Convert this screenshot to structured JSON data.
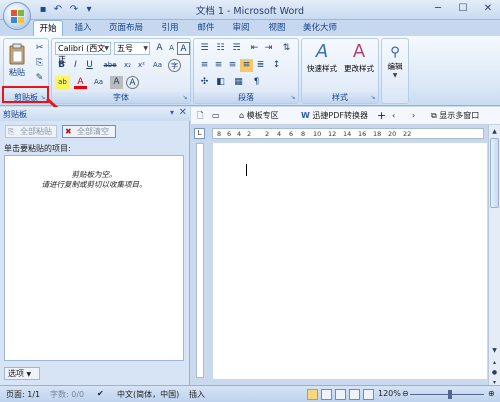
{
  "title_bar": {
    "title": "文档 1 - Microsoft Word",
    "quick_access": [
      "save-icon",
      "undo-icon",
      "redo-icon",
      "customize-icon"
    ],
    "window_buttons": [
      "minimize",
      "maximize",
      "close"
    ]
  },
  "ribbon_tabs": [
    "开始",
    "插入",
    "页面布局",
    "引用",
    "邮件",
    "审阅",
    "视图",
    "美化大师"
  ],
  "active_tab": "开始",
  "clipboard_group": {
    "paste_label": "粘贴",
    "group_label": "剪贴板"
  },
  "font_group": {
    "font_name": "Calibri (西文正",
    "font_size": "五号",
    "group_label": "字体",
    "buttons_row1": [
      "A",
      "A",
      "变",
      "A"
    ],
    "buttons_row2": [
      "B",
      "I",
      "U",
      "abe",
      "x₂",
      "x²",
      "Aa"
    ],
    "buttons_row3": [
      "ab",
      "A",
      "Aa",
      "A",
      "A",
      "字"
    ]
  },
  "paragraph_group": {
    "group_label": "段落"
  },
  "styles_group": {
    "quick_styles": "快速样式",
    "change_styles": "更改样式",
    "group_label": "样式",
    "sample": "AaBb"
  },
  "editing_group": {
    "label": "编辑"
  },
  "clipboard_pane": {
    "title": "剪贴板",
    "paste_all": "全部粘贴",
    "clear_all": "全部清空",
    "hint": "单击要粘贴的项目:",
    "empty_line1": "剪贴板为空。",
    "empty_line2": "请进行复制或剪切以收集项目。",
    "options": "选项"
  },
  "doc_tabs": {
    "template": "模板专区",
    "pdf": "迅捷PDF转换器",
    "add": "+",
    "show_multi": "显示多窗口"
  },
  "ruler_numbers": [
    "8",
    "6",
    "4",
    "2",
    "2",
    "4",
    "6",
    "8",
    "10",
    "12",
    "14",
    "16",
    "18",
    "20",
    "22"
  ],
  "status_bar": {
    "page": "页面: 1/1",
    "words": "字数: 0/0",
    "language": "中文(简体，中国)",
    "insert": "插入",
    "zoom": "120%"
  }
}
